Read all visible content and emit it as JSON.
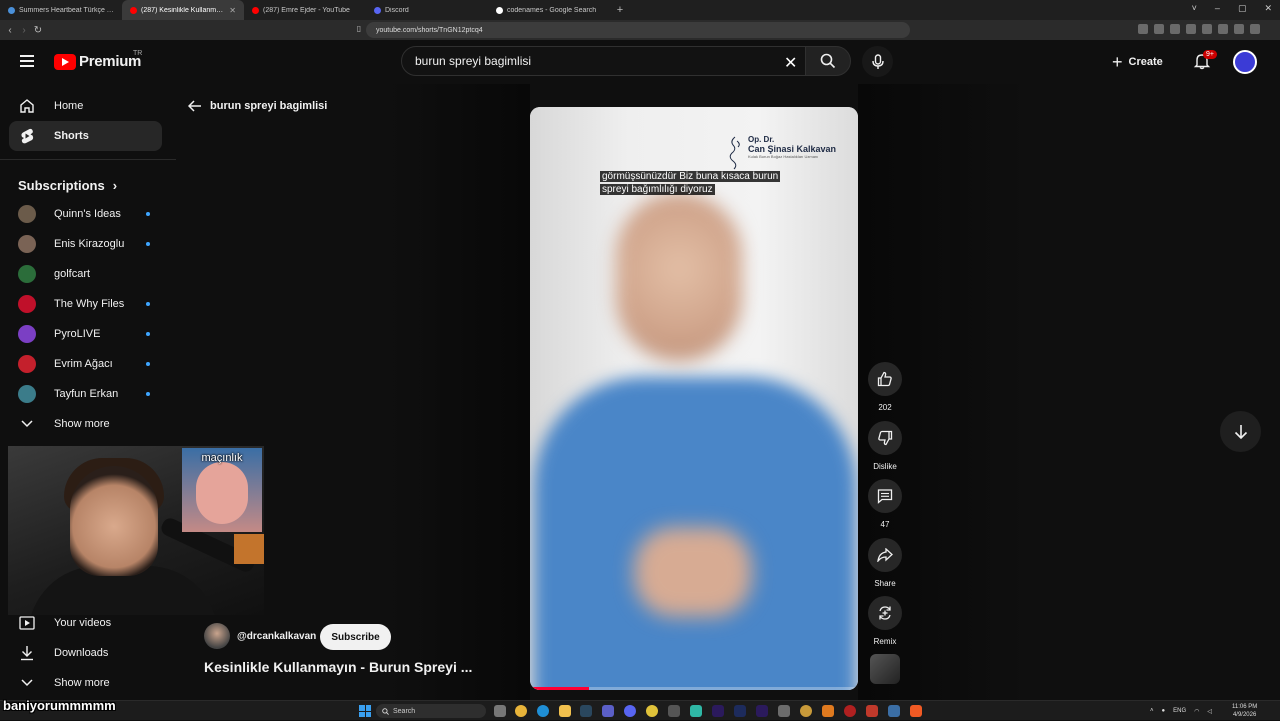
{
  "browser": {
    "tabs": [
      {
        "label": "Summers Heartbeat Türkçe Yama | C",
        "color": "#4a90d9",
        "active": false
      },
      {
        "label": "(287) Kesinlikle Kullanmayın",
        "color": "#ff0000",
        "active": true
      },
      {
        "label": "(287) Emre Ejder - YouTube",
        "color": "#ff0000",
        "active": false
      },
      {
        "label": "Discord",
        "color": "#5865f2",
        "active": false
      },
      {
        "label": "codenames - Google Search",
        "color": "#ffffff",
        "active": false
      }
    ],
    "new_tab": "+",
    "url": "youtube.com/shorts/TnGN12ptcq4",
    "window_controls": [
      "˅",
      "–",
      "▢",
      "✕"
    ]
  },
  "header": {
    "logo_text": "Premium",
    "country_code": "TR",
    "search_value": "burun spreyi bagimlisi",
    "create_label": "Create",
    "notif_badge": "9+"
  },
  "sidebar": {
    "main": [
      {
        "label": "Home",
        "icon": "home-icon"
      },
      {
        "label": "Shorts",
        "icon": "shorts-icon",
        "active": true
      }
    ],
    "subscriptions_title": "Subscriptions",
    "subscriptions": [
      {
        "label": "Quinn's Ideas",
        "color": "#6b5b4a",
        "dot": true
      },
      {
        "label": "Enis Kirazoglu",
        "color": "#7a6355",
        "dot": true
      },
      {
        "label": "golfcart",
        "color": "#2b6d3a",
        "dot": false
      },
      {
        "label": "The Why Files",
        "color": "#c0102a",
        "dot": true
      },
      {
        "label": "PyroLIVE",
        "color": "#7b3fc4",
        "dot": true
      },
      {
        "label": "Evrim Ağacı",
        "color": "#c4202c",
        "dot": true
      },
      {
        "label": "Tayfun Erkan",
        "color": "#3b7c8a",
        "dot": true
      }
    ],
    "show_more": "Show more",
    "you": [
      {
        "label": "Your videos",
        "icon": "your-videos-icon"
      },
      {
        "label": "Downloads",
        "icon": "downloads-icon"
      }
    ],
    "show_more_2": "Show more"
  },
  "webcam": {
    "inset_label": "maçınlık"
  },
  "shorts": {
    "back_title": "burun spreyi bagimlisi",
    "brand_line1": "Op. Dr.",
    "brand_line2": "Can Şinasi Kalkavan",
    "brand_line3": "Kulak Burun Boğaz Hastalıkları Uzmanı",
    "caption_line1": "görmüşsünüzdür Biz buna kısaca burun",
    "caption_line2": "spreyi bağımlılığı diyoruz",
    "progress": 0.18,
    "actions": [
      {
        "name": "like",
        "icon": "thumbs-up-icon",
        "label": "202"
      },
      {
        "name": "dislike",
        "icon": "thumbs-down-icon",
        "label": "Dislike"
      },
      {
        "name": "comments",
        "icon": "comment-icon",
        "label": "47"
      },
      {
        "name": "share",
        "icon": "share-icon",
        "label": "Share"
      },
      {
        "name": "remix",
        "icon": "remix-icon",
        "label": "Remix"
      }
    ],
    "channel_handle": "@drcankalkavan",
    "subscribe_label": "Subscribe",
    "title": "Kesinlikle Kullanmayın - Burun Spreyi ..."
  },
  "overlay_text": "baniyorummmmm",
  "taskbar": {
    "search_placeholder": "Search",
    "lang": "ENG",
    "time": "11:06 PM",
    "date": "4/9/2026"
  }
}
